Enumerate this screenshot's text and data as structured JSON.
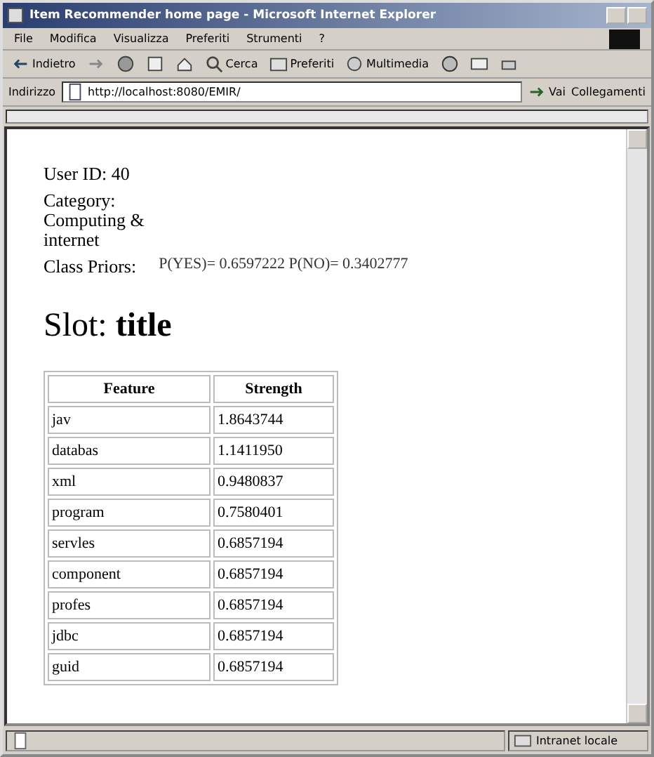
{
  "window": {
    "title": "Item Recommender home page - Microsoft Internet Explorer"
  },
  "menu": [
    "File",
    "Modifica",
    "Visualizza",
    "Preferiti",
    "Strumenti",
    "?"
  ],
  "toolbar": {
    "back": "Indietro",
    "search": "Cerca",
    "favorites": "Preferiti",
    "media": "Multimedia"
  },
  "address_bar": {
    "label": "Indirizzo",
    "value": "http://localhost:8080/EMIR/",
    "go": "Vai",
    "links": "Collegamenti"
  },
  "page": {
    "user_id": "User ID: 40",
    "category": "Category: Computing & internet",
    "priors_label": "Class Priors:",
    "priors_value": "P(YES)= 0.6597222 P(NO)= 0.3402777",
    "slot_label": "Slot:",
    "slot_value": "title"
  },
  "table": {
    "columns": [
      "Feature",
      "Strength"
    ],
    "rows": [
      [
        "jav",
        "1.8643744"
      ],
      [
        "databas",
        "1.1411950"
      ],
      [
        "xml",
        "0.9480837"
      ],
      [
        "program",
        "0.7580401"
      ],
      [
        "servles",
        "0.6857194"
      ],
      [
        "component",
        "0.6857194"
      ],
      [
        "profes",
        "0.6857194"
      ],
      [
        "jdbc",
        "0.6857194"
      ],
      [
        "guid",
        "0.6857194"
      ]
    ]
  },
  "status_bar": {
    "zone": "Intranet locale"
  }
}
